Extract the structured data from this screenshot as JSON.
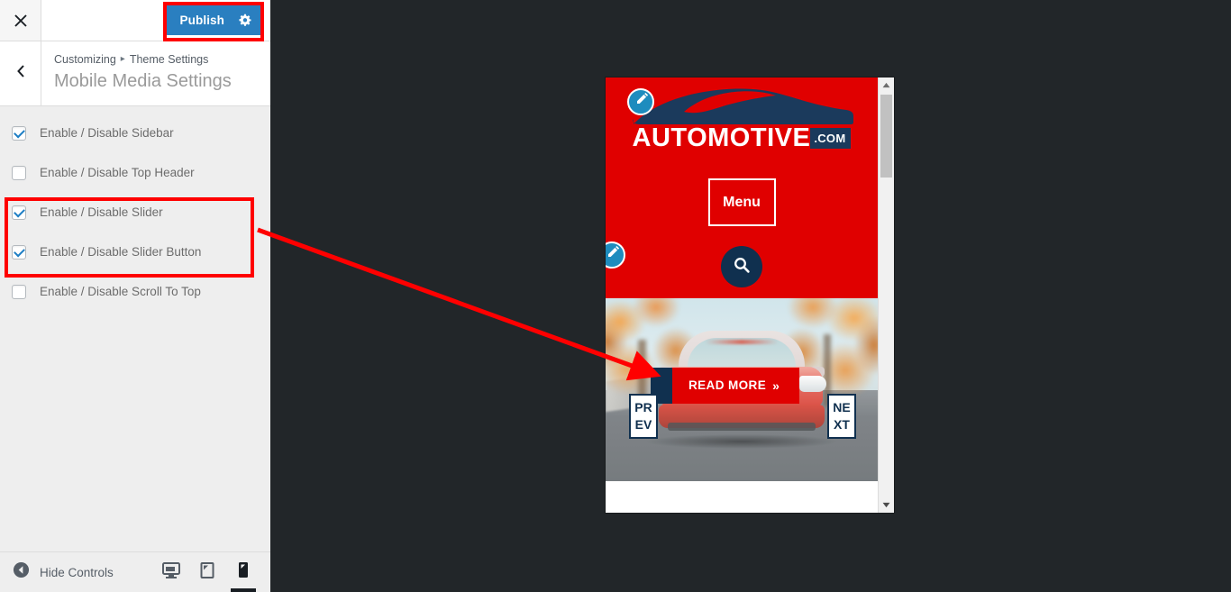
{
  "customizer": {
    "close_label": "Close customizer",
    "publish_label": "Publish",
    "gear_label": "Publish settings",
    "back_label": "Back",
    "breadcrumb": {
      "root": "Customizing",
      "separator": "▸",
      "parent": "Theme Settings"
    },
    "panel_title": "Mobile Media Settings",
    "controls": [
      {
        "label": "Enable / Disable Sidebar",
        "checked": true
      },
      {
        "label": "Enable / Disable Top Header",
        "checked": false
      },
      {
        "label": "Enable / Disable Slider",
        "checked": true
      },
      {
        "label": "Enable / Disable Slider Button",
        "checked": true
      },
      {
        "label": "Enable / Disable Scroll To Top",
        "checked": false
      }
    ],
    "footer": {
      "hide_controls_label": "Hide Controls",
      "devices": [
        {
          "name": "desktop",
          "label": "Enter desktop preview mode",
          "active": false
        },
        {
          "name": "tablet",
          "label": "Enter tablet preview mode",
          "active": false
        },
        {
          "name": "mobile",
          "label": "Enter mobile preview mode",
          "active": true
        }
      ]
    }
  },
  "preview": {
    "device": "mobile",
    "site": {
      "logo": {
        "main_text": "AUTOMOTIVE",
        "tld_text": ".COM"
      },
      "menu_label": "Menu",
      "search_label": "Search",
      "slider": {
        "read_more_label": "READ MORE",
        "read_more_chevron": "»",
        "prev_label": "PREV",
        "next_label": "NEXT"
      },
      "edit_shortcuts": [
        {
          "target": "header-logo"
        },
        {
          "target": "header-search"
        }
      ]
    },
    "scrollbar": {
      "up_label": "Scroll up",
      "down_label": "Scroll down"
    }
  },
  "annotations": [
    {
      "name": "publish-button-highlight",
      "shape": "rect"
    },
    {
      "name": "slider-settings-highlight",
      "shape": "rect"
    },
    {
      "name": "slider-pointer-arrow",
      "shape": "arrow"
    }
  ],
  "colors": {
    "accent_blue": "#2a7fc0",
    "brand_red": "#e00000",
    "brand_navy": "#10304f",
    "annotation_red": "#ff0000",
    "sidebar_bg": "#eeeeee",
    "preview_bg": "#222629"
  }
}
